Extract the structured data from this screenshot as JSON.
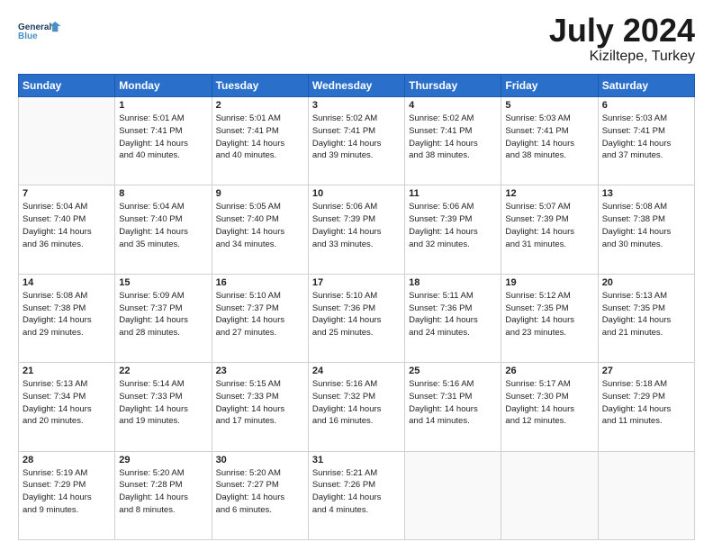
{
  "logo": {
    "line1": "General",
    "line2": "Blue"
  },
  "title": "July 2024",
  "location": "Kiziltepe, Turkey",
  "days_header": [
    "Sunday",
    "Monday",
    "Tuesday",
    "Wednesday",
    "Thursday",
    "Friday",
    "Saturday"
  ],
  "weeks": [
    [
      {
        "day": "",
        "info": ""
      },
      {
        "day": "1",
        "info": "Sunrise: 5:01 AM\nSunset: 7:41 PM\nDaylight: 14 hours\nand 40 minutes."
      },
      {
        "day": "2",
        "info": "Sunrise: 5:01 AM\nSunset: 7:41 PM\nDaylight: 14 hours\nand 40 minutes."
      },
      {
        "day": "3",
        "info": "Sunrise: 5:02 AM\nSunset: 7:41 PM\nDaylight: 14 hours\nand 39 minutes."
      },
      {
        "day": "4",
        "info": "Sunrise: 5:02 AM\nSunset: 7:41 PM\nDaylight: 14 hours\nand 38 minutes."
      },
      {
        "day": "5",
        "info": "Sunrise: 5:03 AM\nSunset: 7:41 PM\nDaylight: 14 hours\nand 38 minutes."
      },
      {
        "day": "6",
        "info": "Sunrise: 5:03 AM\nSunset: 7:41 PM\nDaylight: 14 hours\nand 37 minutes."
      }
    ],
    [
      {
        "day": "7",
        "info": "Sunrise: 5:04 AM\nSunset: 7:40 PM\nDaylight: 14 hours\nand 36 minutes."
      },
      {
        "day": "8",
        "info": "Sunrise: 5:04 AM\nSunset: 7:40 PM\nDaylight: 14 hours\nand 35 minutes."
      },
      {
        "day": "9",
        "info": "Sunrise: 5:05 AM\nSunset: 7:40 PM\nDaylight: 14 hours\nand 34 minutes."
      },
      {
        "day": "10",
        "info": "Sunrise: 5:06 AM\nSunset: 7:39 PM\nDaylight: 14 hours\nand 33 minutes."
      },
      {
        "day": "11",
        "info": "Sunrise: 5:06 AM\nSunset: 7:39 PM\nDaylight: 14 hours\nand 32 minutes."
      },
      {
        "day": "12",
        "info": "Sunrise: 5:07 AM\nSunset: 7:39 PM\nDaylight: 14 hours\nand 31 minutes."
      },
      {
        "day": "13",
        "info": "Sunrise: 5:08 AM\nSunset: 7:38 PM\nDaylight: 14 hours\nand 30 minutes."
      }
    ],
    [
      {
        "day": "14",
        "info": "Sunrise: 5:08 AM\nSunset: 7:38 PM\nDaylight: 14 hours\nand 29 minutes."
      },
      {
        "day": "15",
        "info": "Sunrise: 5:09 AM\nSunset: 7:37 PM\nDaylight: 14 hours\nand 28 minutes."
      },
      {
        "day": "16",
        "info": "Sunrise: 5:10 AM\nSunset: 7:37 PM\nDaylight: 14 hours\nand 27 minutes."
      },
      {
        "day": "17",
        "info": "Sunrise: 5:10 AM\nSunset: 7:36 PM\nDaylight: 14 hours\nand 25 minutes."
      },
      {
        "day": "18",
        "info": "Sunrise: 5:11 AM\nSunset: 7:36 PM\nDaylight: 14 hours\nand 24 minutes."
      },
      {
        "day": "19",
        "info": "Sunrise: 5:12 AM\nSunset: 7:35 PM\nDaylight: 14 hours\nand 23 minutes."
      },
      {
        "day": "20",
        "info": "Sunrise: 5:13 AM\nSunset: 7:35 PM\nDaylight: 14 hours\nand 21 minutes."
      }
    ],
    [
      {
        "day": "21",
        "info": "Sunrise: 5:13 AM\nSunset: 7:34 PM\nDaylight: 14 hours\nand 20 minutes."
      },
      {
        "day": "22",
        "info": "Sunrise: 5:14 AM\nSunset: 7:33 PM\nDaylight: 14 hours\nand 19 minutes."
      },
      {
        "day": "23",
        "info": "Sunrise: 5:15 AM\nSunset: 7:33 PM\nDaylight: 14 hours\nand 17 minutes."
      },
      {
        "day": "24",
        "info": "Sunrise: 5:16 AM\nSunset: 7:32 PM\nDaylight: 14 hours\nand 16 minutes."
      },
      {
        "day": "25",
        "info": "Sunrise: 5:16 AM\nSunset: 7:31 PM\nDaylight: 14 hours\nand 14 minutes."
      },
      {
        "day": "26",
        "info": "Sunrise: 5:17 AM\nSunset: 7:30 PM\nDaylight: 14 hours\nand 12 minutes."
      },
      {
        "day": "27",
        "info": "Sunrise: 5:18 AM\nSunset: 7:29 PM\nDaylight: 14 hours\nand 11 minutes."
      }
    ],
    [
      {
        "day": "28",
        "info": "Sunrise: 5:19 AM\nSunset: 7:29 PM\nDaylight: 14 hours\nand 9 minutes."
      },
      {
        "day": "29",
        "info": "Sunrise: 5:20 AM\nSunset: 7:28 PM\nDaylight: 14 hours\nand 8 minutes."
      },
      {
        "day": "30",
        "info": "Sunrise: 5:20 AM\nSunset: 7:27 PM\nDaylight: 14 hours\nand 6 minutes."
      },
      {
        "day": "31",
        "info": "Sunrise: 5:21 AM\nSunset: 7:26 PM\nDaylight: 14 hours\nand 4 minutes."
      },
      {
        "day": "",
        "info": ""
      },
      {
        "day": "",
        "info": ""
      },
      {
        "day": "",
        "info": ""
      }
    ]
  ]
}
